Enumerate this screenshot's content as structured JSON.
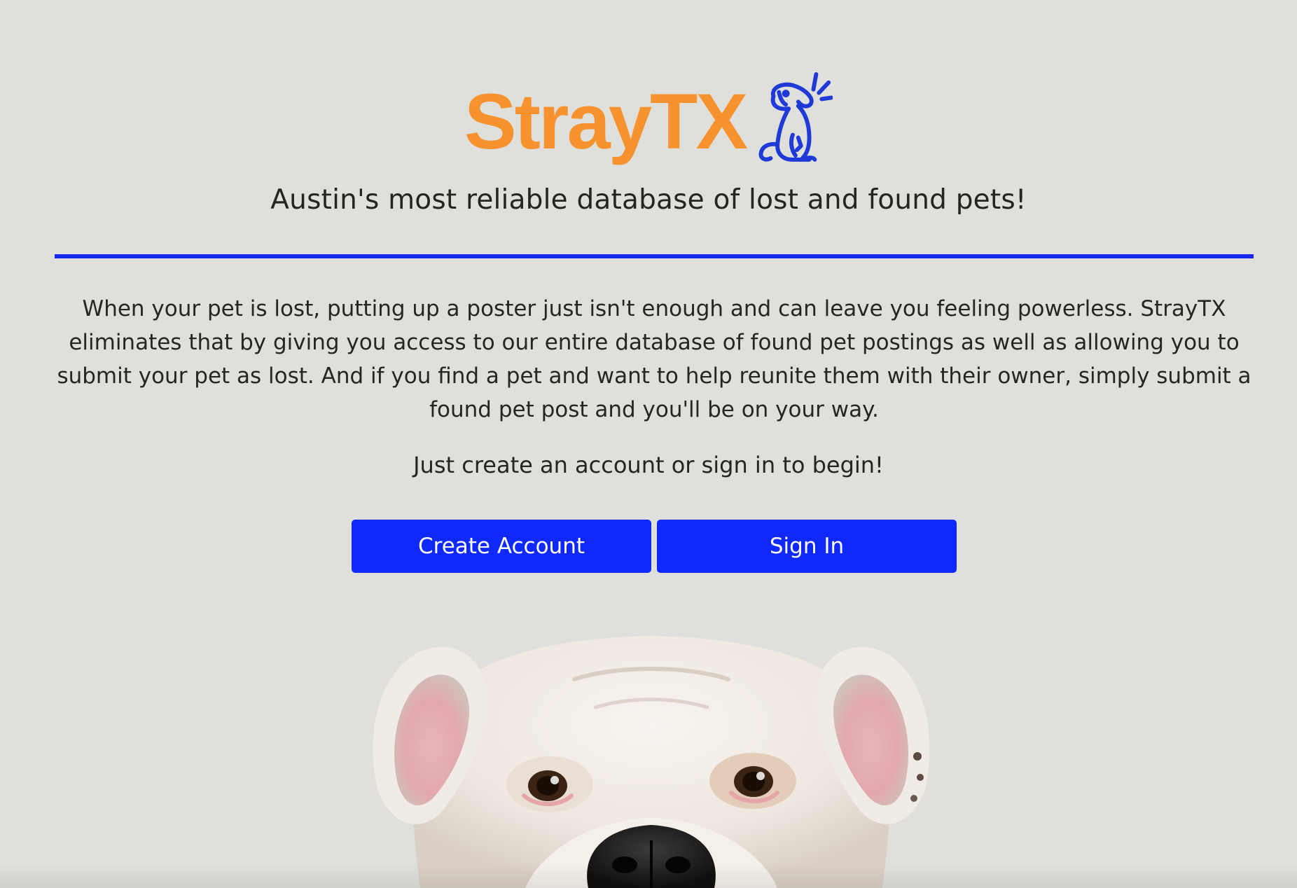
{
  "brand": {
    "logo_text": "StrayTX",
    "logo_color": "#f7932e",
    "icon": "dog-icon",
    "icon_color": "#1f3ad6"
  },
  "hero": {
    "tagline": "Austin's most reliable database of lost and found pets!",
    "description": "When your pet is lost, putting up a poster just isn't enough and can leave you feeling powerless. StrayTX eliminates that by giving you access to our entire database of found pet postings as well as allowing you to submit your pet as lost. And if you find a pet and want to help reunite them with their owner, simply submit a found pet post and you'll be on your way.",
    "call_to_action": "Just create an account or sign in to begin!"
  },
  "actions": {
    "create_account_label": "Create Account",
    "sign_in_label": "Sign In"
  },
  "colors": {
    "background": "#dfdfdb",
    "accent": "#0f28fb",
    "divider": "#1429ec"
  },
  "image": {
    "subject": "bulldog-photo"
  }
}
